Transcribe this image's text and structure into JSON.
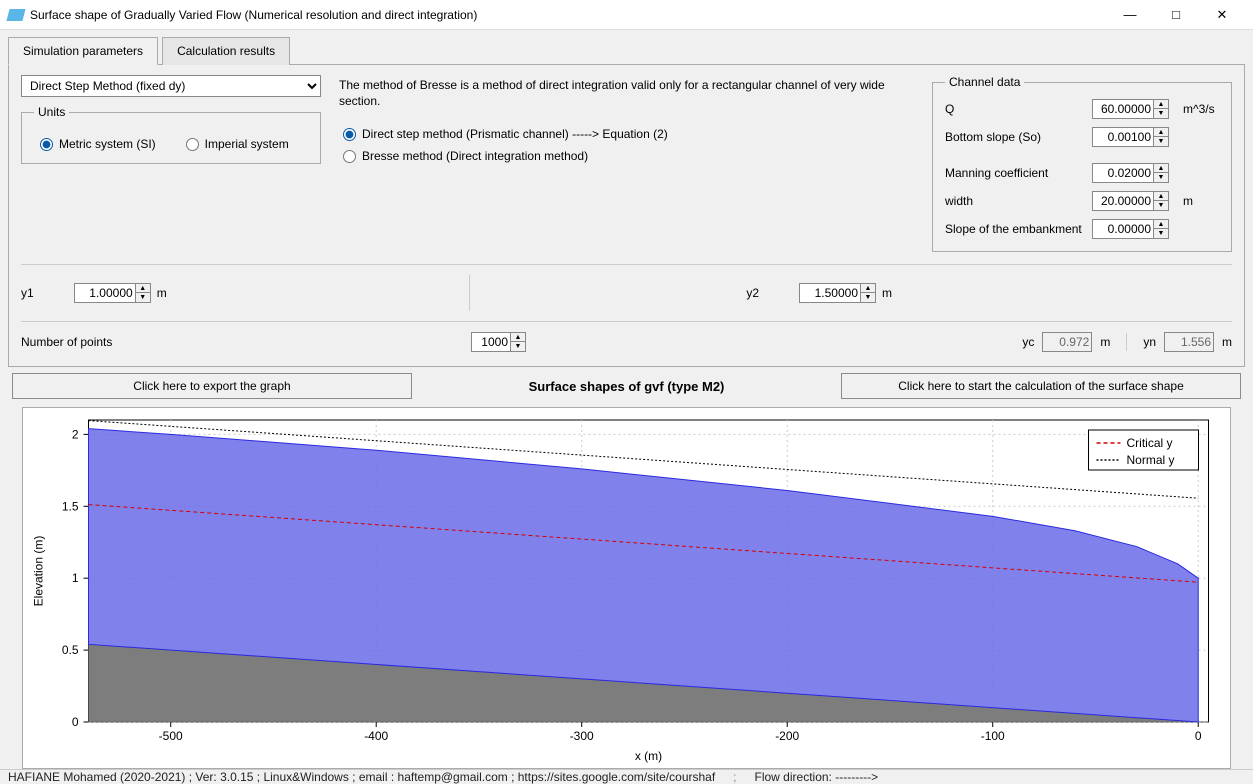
{
  "window": {
    "title": "Surface shape of Gradually Varied Flow (Numerical resolution and direct integration)"
  },
  "tabs": {
    "sim": "Simulation parameters",
    "results": "Calculation results"
  },
  "method_select": "Direct Step Method (fixed dy)",
  "units": {
    "legend": "Units",
    "metric": "Metric system (SI)",
    "imperial": "Imperial system"
  },
  "bresse_desc": "The method of Bresse is a method of direct integration valid only for a rectangular channel of very wide section.",
  "method_radio": {
    "direct": "Direct step method (Prismatic channel) -----> Equation (2)",
    "bresse": "Bresse method (Direct integration method)"
  },
  "channel": {
    "legend": "Channel data",
    "q_label": "Q",
    "q_value": "60.00000",
    "q_unit": "m^3/s",
    "so_label": "Bottom slope (So)",
    "so_value": "0.00100",
    "n_label": "Manning coefficient",
    "n_value": "0.02000",
    "w_label": "width",
    "w_value": "20.00000",
    "w_unit": "m",
    "emb_label": "Slope of the embankment",
    "emb_value": "0.00000"
  },
  "y1": {
    "label": "y1",
    "value": "1.00000",
    "unit": "m"
  },
  "y2": {
    "label": "y2",
    "value": "1.50000",
    "unit": "m"
  },
  "npoints": {
    "label": "Number of points",
    "value": "1000"
  },
  "yc": {
    "label": "yc",
    "value": "0.972",
    "unit": "m"
  },
  "yn": {
    "label": "yn",
    "value": "1.556",
    "unit": "m"
  },
  "actions": {
    "export": "Click here to export the graph",
    "title": "Surface shapes of gvf (type M2)",
    "calc": "Click here to start the calculation of the surface shape"
  },
  "status": {
    "left": "HAFIANE Mohamed (2020-2021) ; Ver: 3.0.15 ; Linux&Windows ; email : haftemp@gmail.com ; https://sites.google.com/site/courshaf",
    "right": "Flow direction: --------->"
  },
  "chart_data": {
    "type": "area",
    "xlabel": "x (m)",
    "ylabel": "Elevation (m)",
    "xlim": [
      -540,
      5
    ],
    "ylim": [
      0,
      2.1
    ],
    "xticks": [
      -500,
      -400,
      -300,
      -200,
      -100,
      0
    ],
    "yticks": [
      0,
      0.5,
      1,
      1.5,
      2
    ],
    "legend": {
      "critical": "Critical y",
      "normal": "Normal y"
    },
    "series": [
      {
        "name": "Channel bottom",
        "role": "bottom_area",
        "color": "#7d7d7d",
        "points": [
          {
            "x": -540,
            "y": 0.54
          },
          {
            "x": 0,
            "y": 0.0
          }
        ]
      },
      {
        "name": "Water surface",
        "role": "water_area_top",
        "color": "#6b6be8",
        "points": [
          {
            "x": -540,
            "y": 2.04
          },
          {
            "x": -500,
            "y": 2.0
          },
          {
            "x": -400,
            "y": 1.89
          },
          {
            "x": -300,
            "y": 1.76
          },
          {
            "x": -200,
            "y": 1.61
          },
          {
            "x": -100,
            "y": 1.43
          },
          {
            "x": -60,
            "y": 1.33
          },
          {
            "x": -30,
            "y": 1.22
          },
          {
            "x": -10,
            "y": 1.1
          },
          {
            "x": 0,
            "y": 1.0
          }
        ]
      },
      {
        "name": "Critical y",
        "role": "critical_line",
        "color": "#d40000",
        "dash": "4 3",
        "points": [
          {
            "x": -540,
            "y": 1.512
          },
          {
            "x": 0,
            "y": 0.972
          }
        ]
      },
      {
        "name": "Normal y",
        "role": "normal_line",
        "color": "#000000",
        "dash": "2 2",
        "points": [
          {
            "x": -540,
            "y": 2.096
          },
          {
            "x": 0,
            "y": 1.556
          }
        ]
      }
    ]
  }
}
